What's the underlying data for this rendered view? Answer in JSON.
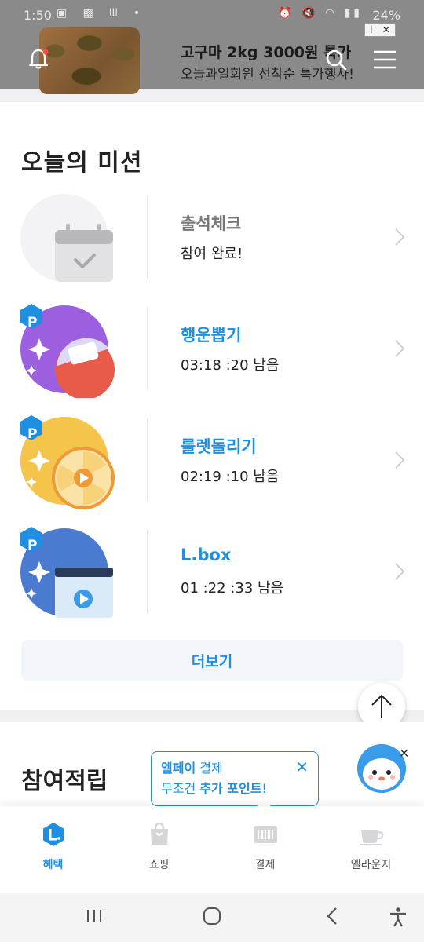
{
  "status_bar": {
    "time": "1:50",
    "battery": "24%"
  },
  "ad": {
    "title": "고구마 2kg 3000원 특가",
    "subtitle": "오늘과일회원 선착순 특가행사!",
    "badge_info": "i",
    "badge_close": "✕"
  },
  "missions": {
    "title": "오늘의 미션",
    "items": [
      {
        "label": "출석체크",
        "status": "참여 완료!",
        "icon": "calendar-check-icon",
        "point_badge": ""
      },
      {
        "label": "행운뽑기",
        "status": "03:18 :20 남음",
        "icon": "capsule-gacha-icon",
        "point_badge": "P"
      },
      {
        "label": "룰렛돌리기",
        "status": "02:19 :10 남음",
        "icon": "roulette-wheel-icon",
        "point_badge": "P"
      },
      {
        "label": "L.box",
        "status": "01 :22 :33 남음",
        "icon": "video-card-icon",
        "point_badge": "P"
      }
    ],
    "more_label": "더보기"
  },
  "earn_section": {
    "title": "참여적립"
  },
  "tooltip": {
    "brand": "엘페이",
    "line1_rest": " 결제",
    "line2_pre": "무조건 ",
    "line2_strong": "추가 포인트",
    "line2_post": "!",
    "close": "✕"
  },
  "mascot_close": "✕",
  "bottom_nav": {
    "items": [
      {
        "label": "혜택",
        "active": true
      },
      {
        "label": "쇼핑",
        "active": false
      },
      {
        "label": "결제",
        "active": false
      },
      {
        "label": "엘라운지",
        "active": false
      }
    ]
  },
  "colors": {
    "accent": "#1e8fe1",
    "purple": "#9b5fe0",
    "yellow": "#f5c44a",
    "blue_card": "#4a7bd0"
  }
}
